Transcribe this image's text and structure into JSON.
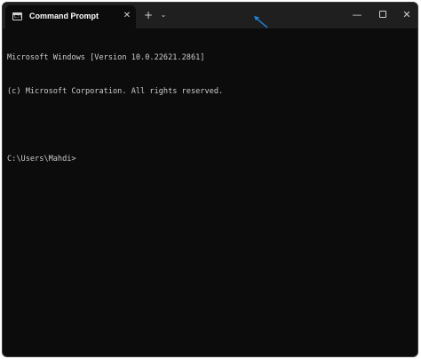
{
  "window": {
    "tab_title": "Command Prompt",
    "tab_icon": "cmd-icon",
    "tab_close_icon": "✕",
    "new_tab_icon": "+",
    "dropdown_icon": "⌄",
    "minimize_icon": "—",
    "close_icon": "✕"
  },
  "terminal": {
    "lines": [
      "Microsoft Windows [Version 10.0.22621.2861]",
      "(c) Microsoft Corporation. All rights reserved.",
      "",
      "C:\\Users\\Mahdi>"
    ]
  },
  "colors": {
    "terminal_bg": "#0c0c0c",
    "titlebar_bg": "#1f1f1f",
    "text": "#cccccc",
    "annotation_arrow": "#1e88e5"
  }
}
